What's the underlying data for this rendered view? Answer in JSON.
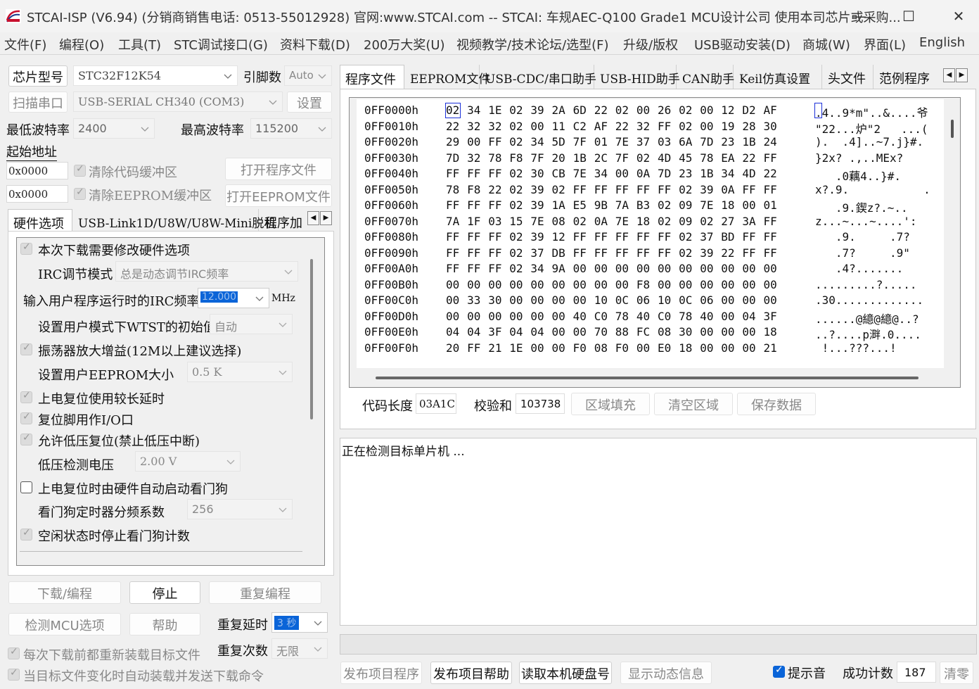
{
  "window": {
    "title": "STCAI-ISP (V6.94) (分销商销售电话: 0513-55012928) 官网:www.STCAI.com  -- STCAI: 车规AEC-Q100 Grade1 MCU设计公司 使用本司芯片或采购...",
    "minimize": "—",
    "maximize": "☐",
    "close": "✕"
  },
  "menu": [
    "文件(F)",
    "编程(O)",
    "工具(T)",
    "STC调试接口(G)",
    "资料下载(D)",
    "200万大奖(U)",
    "视频教学/技术论坛/选型(F)",
    "升级/版权",
    "USB驱动安装(D)",
    "商城(W)",
    "界面(L)",
    "English"
  ],
  "left": {
    "chip_label": "芯片型号",
    "chip_value": "STC32F12K54",
    "pins_label": "引脚数",
    "pins_value": "Auto",
    "scan_label": "扫描串口",
    "port_value": "USB-SERIAL CH340 (COM3)",
    "settings_label": "设置",
    "min_baud_label": "最低波特率",
    "min_baud_value": "2400",
    "max_baud_label": "最高波特率",
    "max_baud_value": "115200",
    "start_addr_label": "起始地址",
    "addr1": "0x0000",
    "clear_code_label": "清除代码缓冲区",
    "open_prog_label": "打开程序文件",
    "addr2": "0x0000",
    "clear_eeprom_label": "清除EEPROM缓冲区",
    "open_eeprom_label": "打开EEPROM文件",
    "tabs": [
      "硬件选项",
      "USB-Link1D/U8W/U8W-Mini脱机",
      "程序加"
    ],
    "options": {
      "modify_hw": "本次下载需要修改硬件选项",
      "irc_mode_label": "IRC调节模式",
      "irc_mode_value": "总是动态调节IRC频率",
      "irc_freq_label": "输入用户程序运行时的IRC频率",
      "irc_freq_value": "12.000",
      "irc_freq_unit": "MHz",
      "wdt_init_label": "设置用户模式下WTST的初始值",
      "wdt_init_value": "自动",
      "osc_gain": "振荡器放大增益(12M以上建议选择)",
      "eeprom_size_label": "设置用户EEPROM大小",
      "eeprom_size_value": "0.5 K",
      "por_delay": "上电复位使用较长延时",
      "reset_io": "复位脚用作I/O口",
      "lvr": "允许低压复位(禁止低压中断)",
      "lvd_label": "低压检测电压",
      "lvd_value": "2.00 V",
      "wdt_auto": "上电复位时由硬件自动启动看门狗",
      "wdt_div_label": "看门狗定时器分频系数",
      "wdt_div_value": "256",
      "idle_wdt": "空闲状态时停止看门狗计数"
    },
    "download_label": "下载/编程",
    "stop_label": "停止",
    "reprogram_label": "重复编程",
    "check_mcu_label": "检测MCU选项",
    "help_label": "帮助",
    "repeat_delay_label": "重复延时",
    "repeat_delay_value": "3 秒",
    "reload_label": "每次下载前都重新装载目标文件",
    "repeat_count_label": "重复次数",
    "repeat_count_value": "无限",
    "auto_send_label": "当目标文件变化时自动装载并发送下载命令"
  },
  "right": {
    "tabs": [
      "程序文件",
      "EEPROM文件",
      "USB-CDC/串口助手",
      "USB-HID助手",
      "CAN助手",
      "Keil仿真设置",
      "头文件",
      "范例程序"
    ],
    "hex_rows": [
      {
        "addr": "0FF0000h",
        "bytes": [
          "02",
          "34",
          "1E",
          "02",
          "39",
          "2A",
          "6D",
          "22",
          "02",
          "00",
          "26",
          "02",
          "00",
          "12",
          "D2",
          "AF"
        ],
        "ascii": ".4..9*m\"..&....爷"
      },
      {
        "addr": "0FF0010h",
        "bytes": [
          "22",
          "32",
          "32",
          "02",
          "00",
          "11",
          "C2",
          "AF",
          "22",
          "32",
          "FF",
          "02",
          "00",
          "19",
          "28",
          "30"
        ],
        "ascii": "\"22...炉\"2   ...("
      },
      {
        "addr": "0FF0020h",
        "bytes": [
          "29",
          "00",
          "FF",
          "02",
          "34",
          "5D",
          "7F",
          "01",
          "7E",
          "37",
          "03",
          "6A",
          "7D",
          "23",
          "1B",
          "24"
        ],
        "ascii": ").  .4]..~7.j}#."
      },
      {
        "addr": "0FF0030h",
        "bytes": [
          "7D",
          "32",
          "78",
          "F8",
          "7F",
          "20",
          "1B",
          "2C",
          "7F",
          "02",
          "4D",
          "45",
          "78",
          "EA",
          "22",
          "FF"
        ],
        "ascii": "}2x? .,..MEx?"
      },
      {
        "addr": "0FF0040h",
        "bytes": [
          "FF",
          "FF",
          "FF",
          "02",
          "30",
          "CB",
          "7E",
          "34",
          "00",
          "0A",
          "7D",
          "23",
          "1B",
          "34",
          "4D",
          "22"
        ],
        "ascii": "   .0藕4..}#."
      },
      {
        "addr": "0FF0050h",
        "bytes": [
          "78",
          "F8",
          "22",
          "02",
          "39",
          "02",
          "FF",
          "FF",
          "FF",
          "FF",
          "FF",
          "02",
          "39",
          "0A",
          "FF",
          "FF"
        ],
        "ascii": "x?.9.           ."
      },
      {
        "addr": "0FF0060h",
        "bytes": [
          "FF",
          "FF",
          "FF",
          "02",
          "39",
          "1A",
          "E5",
          "9B",
          "7A",
          "B3",
          "02",
          "09",
          "7E",
          "18",
          "00",
          "01"
        ],
        "ascii": "   .9.鍥z?.~.."
      },
      {
        "addr": "0FF0070h",
        "bytes": [
          "7A",
          "1F",
          "03",
          "15",
          "7E",
          "08",
          "02",
          "0A",
          "7E",
          "18",
          "02",
          "09",
          "02",
          "27",
          "3A",
          "FF"
        ],
        "ascii": "z...~...~....':"
      },
      {
        "addr": "0FF0080h",
        "bytes": [
          "FF",
          "FF",
          "FF",
          "02",
          "39",
          "12",
          "FF",
          "FF",
          "FF",
          "FF",
          "FF",
          "02",
          "37",
          "BD",
          "FF",
          "FF"
        ],
        "ascii": "   .9.     .7?"
      },
      {
        "addr": "0FF0090h",
        "bytes": [
          "FF",
          "FF",
          "FF",
          "02",
          "37",
          "DB",
          "FF",
          "FF",
          "FF",
          "FF",
          "FF",
          "02",
          "39",
          "22",
          "FF",
          "FF"
        ],
        "ascii": "   .7?     .9\""
      },
      {
        "addr": "0FF00A0h",
        "bytes": [
          "FF",
          "FF",
          "FF",
          "02",
          "34",
          "9A",
          "00",
          "00",
          "00",
          "00",
          "00",
          "00",
          "00",
          "00",
          "00",
          "00"
        ],
        "ascii": "   .4?......."
      },
      {
        "addr": "0FF00B0h",
        "bytes": [
          "00",
          "00",
          "00",
          "00",
          "00",
          "00",
          "00",
          "00",
          "00",
          "F8",
          "00",
          "00",
          "00",
          "00",
          "00",
          "00"
        ],
        "ascii": ".........?....."
      },
      {
        "addr": "0FF00C0h",
        "bytes": [
          "00",
          "33",
          "30",
          "00",
          "00",
          "00",
          "00",
          "10",
          "0C",
          "06",
          "10",
          "0C",
          "06",
          "00",
          "00",
          "00"
        ],
        "ascii": ".30............."
      },
      {
        "addr": "0FF00D0h",
        "bytes": [
          "00",
          "00",
          "00",
          "00",
          "00",
          "00",
          "40",
          "C0",
          "78",
          "40",
          "C0",
          "78",
          "40",
          "00",
          "04",
          "3F"
        ],
        "ascii": "......@繶@繶@..?"
      },
      {
        "addr": "0FF00E0h",
        "bytes": [
          "04",
          "04",
          "3F",
          "04",
          "04",
          "00",
          "00",
          "70",
          "88",
          "FC",
          "08",
          "30",
          "00",
          "00",
          "00",
          "18"
        ],
        "ascii": "..?....p溿.0...."
      },
      {
        "addr": "0FF00F0h",
        "bytes": [
          "20",
          "FF",
          "21",
          "1E",
          "00",
          "00",
          "F0",
          "08",
          "F0",
          "00",
          "E0",
          "18",
          "00",
          "00",
          "00",
          "21"
        ],
        "ascii": " !...???...!"
      }
    ],
    "code_len_label": "代码长度",
    "code_len_value": "03A1C",
    "checksum_label": "校验和",
    "checksum_value": "103738",
    "fill_label": "区域填充",
    "clear_area_label": "清空区域",
    "save_label": "保存数据",
    "log_text": "正在检测目标单片机 ...",
    "publish_prog_label": "发布项目程序",
    "publish_help_label": "发布项目帮助",
    "read_disk_label": "读取本机硬盘号",
    "show_dynamic_label": "显示动态信息",
    "beep_label": "提示音",
    "success_label": "成功计数",
    "success_value": "187",
    "clear_zero_label": "清零"
  }
}
